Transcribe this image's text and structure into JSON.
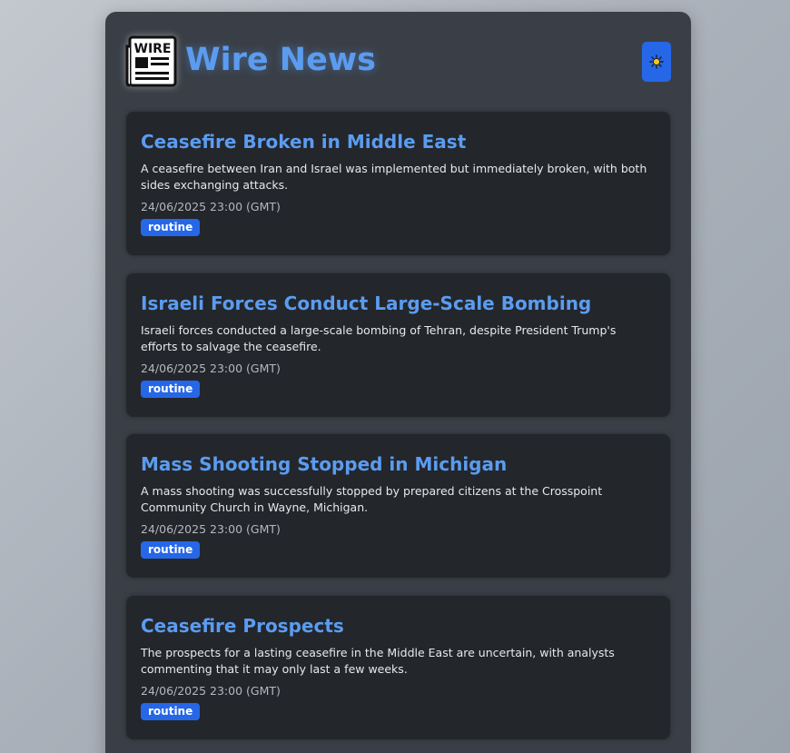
{
  "header": {
    "logo_text": "WIRE",
    "title": "Wire News",
    "theme_toggle_icon": "sun-icon"
  },
  "colors": {
    "accent": "#5b9cf0",
    "button": "#2667e8",
    "card_bg": "#23262b",
    "panel_bg": "#3a3f47"
  },
  "articles": [
    {
      "title": "Ceasefire Broken in Middle East",
      "summary": "A ceasefire between Iran and Israel was implemented but immediately broken, with both sides exchanging attacks.",
      "timestamp": "24/06/2025 23:00 (GMT)",
      "tag": "routine"
    },
    {
      "title": "Israeli Forces Conduct Large-Scale Bombing",
      "summary": "Israeli forces conducted a large-scale bombing of Tehran, despite President Trump's efforts to salvage the ceasefire.",
      "timestamp": "24/06/2025 23:00 (GMT)",
      "tag": "routine"
    },
    {
      "title": "Mass Shooting Stopped in Michigan",
      "summary": "A mass shooting was successfully stopped by prepared citizens at the Crosspoint Community Church in Wayne, Michigan.",
      "timestamp": "24/06/2025 23:00 (GMT)",
      "tag": "routine"
    },
    {
      "title": "Ceasefire Prospects",
      "summary": "The prospects for a lasting ceasefire in the Middle East are uncertain, with analysts commenting that it may only last a few weeks.",
      "timestamp": "24/06/2025 23:00 (GMT)",
      "tag": "routine"
    }
  ]
}
